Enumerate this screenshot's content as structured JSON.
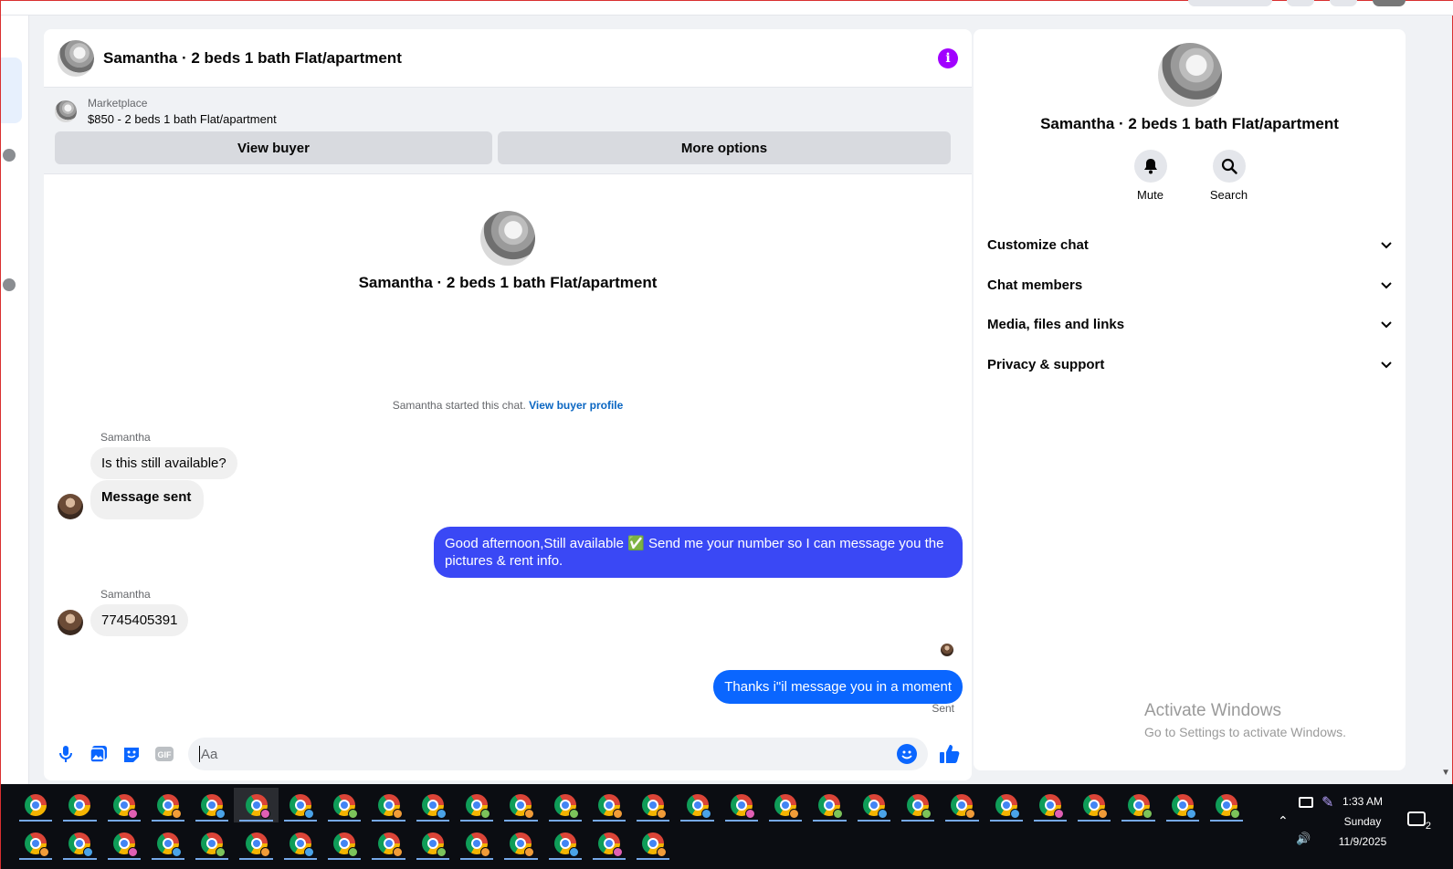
{
  "chat": {
    "title": "Samantha · 2 beds 1 bath Flat/apartment",
    "marketplace_label": "Marketplace",
    "listing": "$850 - 2 beds 1 bath Flat/apartment",
    "view_buyer": "View buyer",
    "more_options": "More options",
    "intro_title": "Samantha · 2 beds 1 bath Flat/apartment",
    "started_text": "Samantha started this chat.",
    "started_link": "View buyer profile",
    "messages": [
      {
        "sender": "Samantha",
        "text": "Is this still available?"
      },
      {
        "text": "Message sent"
      },
      {
        "text": "Good afternoon,Still available ✅ Send me your number so I can message you the pictures & rent info."
      },
      {
        "sender": "Samantha",
        "text": "7745405391"
      },
      {
        "text": "Thanks i\"il message you in a moment",
        "status": "Sent"
      }
    ],
    "composer_placeholder": "Aa"
  },
  "info": {
    "title": "Samantha · 2 beds 1 bath Flat/apartment",
    "actions": [
      {
        "label": "Mute",
        "icon": "bell-icon"
      },
      {
        "label": "Search",
        "icon": "search-icon"
      }
    ],
    "menu": [
      "Customize chat",
      "Chat members",
      "Media, files and links",
      "Privacy & support"
    ]
  },
  "watermark": {
    "line1": "Activate Windows",
    "line2": "Go to Settings to activate Windows."
  },
  "taskbar": {
    "time": "1:33 AM",
    "day": "Sunday",
    "date": "11/9/2025",
    "notifications": "2"
  },
  "colors": {
    "accent": "#0a66ff",
    "outgoing": "#3a48f5",
    "info": "#a100ff"
  }
}
